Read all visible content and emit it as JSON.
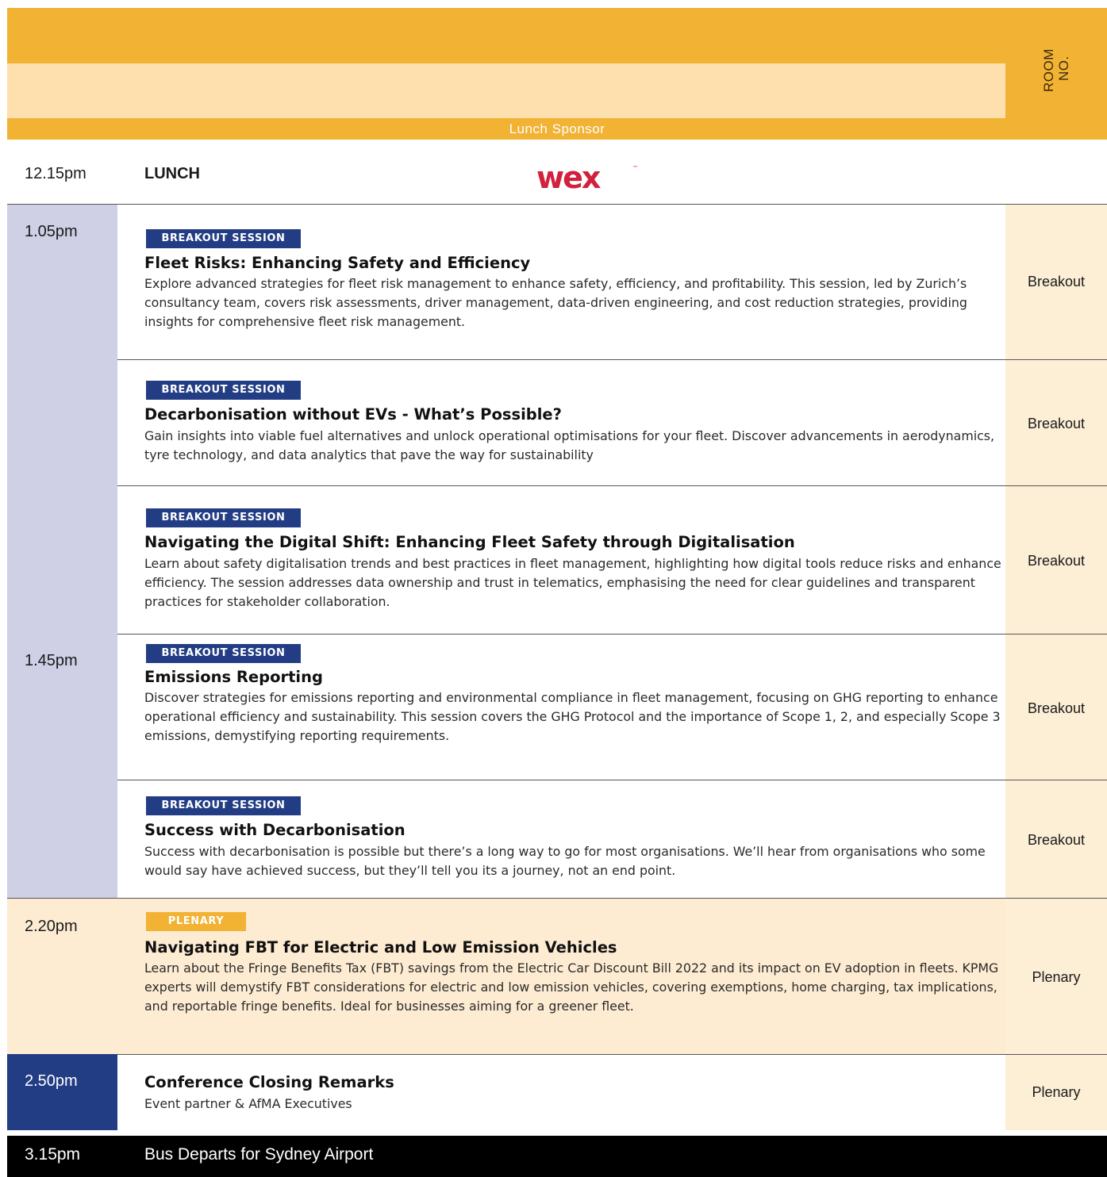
{
  "header": {
    "room_label_line1": "ROOM",
    "room_label_line2": "NO.",
    "sponsor_label": "Lunch Sponsor"
  },
  "lunch": {
    "time": "12.15pm",
    "title": "LUNCH",
    "sponsor_logo": "wex",
    "sponsor_logo_mark": "™"
  },
  "times": {
    "t1": "1.05pm",
    "t2": "1.45pm",
    "t3": "2.20pm",
    "t4": "2.50pm"
  },
  "sessions": [
    {
      "badge": "BREAKOUT SESSION",
      "title": "Fleet Risks: Enhancing Safety and Efficiency",
      "desc": "Explore advanced strategies for fleet risk management to enhance safety, efficiency, and profitability. This session, led by Zurich’s consultancy team, covers risk assessments, driver management, data-driven engineering, and cost reduction strategies, providing insights for comprehensive fleet risk management.",
      "room": "Breakout"
    },
    {
      "badge": "BREAKOUT SESSION",
      "title": "Decarbonisation without EVs - What’s Possible?",
      "desc": "Gain insights into viable fuel alternatives and unlock operational optimisations for your fleet. Discover advancements in aerodynamics, tyre technology, and data analytics that pave the way for sustainability",
      "room": "Breakout"
    },
    {
      "badge": "BREAKOUT SESSION",
      "title": "Navigating the Digital Shift: Enhancing Fleet Safety through Digitalisation",
      "desc": "Learn about safety digitalisation trends and best practices in fleet management, highlighting how digital tools reduce risks and enhance efficiency. The session addresses data ownership and trust in telematics, emphasising the need for clear guidelines and transparent practices for stakeholder collaboration.",
      "room": "Breakout"
    },
    {
      "badge": "BREAKOUT SESSION",
      "title": "Emissions Reporting",
      "desc": "Discover strategies for emissions reporting and environmental compliance in fleet management, focusing on GHG reporting to enhance operational efficiency and sustainability. This session covers the GHG Protocol and the importance of Scope 1, 2, and especially Scope 3 emissions, demystifying reporting requirements.",
      "room": "Breakout"
    },
    {
      "badge": "BREAKOUT SESSION",
      "title": "Success with Decarbonisation",
      "desc": "Success with decarbonisation is possible but there’s a long way to go for most organisations. We’ll hear from organisations who some would say have achieved success, but they’ll tell you its a journey, not an end point.",
      "room": "Breakout"
    },
    {
      "badge": "PLENARY",
      "title": "Navigating FBT for Electric and Low Emission Vehicles",
      "desc": "Learn about the Fringe Benefits Tax (FBT) savings from the Electric Car Discount Bill 2022 and its impact on EV adoption in fleets. KPMG experts will demystify FBT considerations for electric and low emission vehicles, covering exemptions, home charging, tax implications, and reportable fringe benefits. Ideal for businesses aiming for a greener fleet.",
      "room": "Plenary"
    }
  ],
  "closing": {
    "title": "Conference Closing Remarks",
    "desc": "Event partner & AfMA Executives",
    "room": "Plenary"
  },
  "footer": {
    "time": "3.15pm",
    "text": "Bus Departs for Sydney Airport"
  },
  "colors": {
    "gold": "#f2b233",
    "light_gold": "#fde0ad",
    "navy": "#233d85",
    "lavender": "#cfcfe6",
    "cream": "#fdecd2",
    "wex_red": "#d1213d"
  }
}
